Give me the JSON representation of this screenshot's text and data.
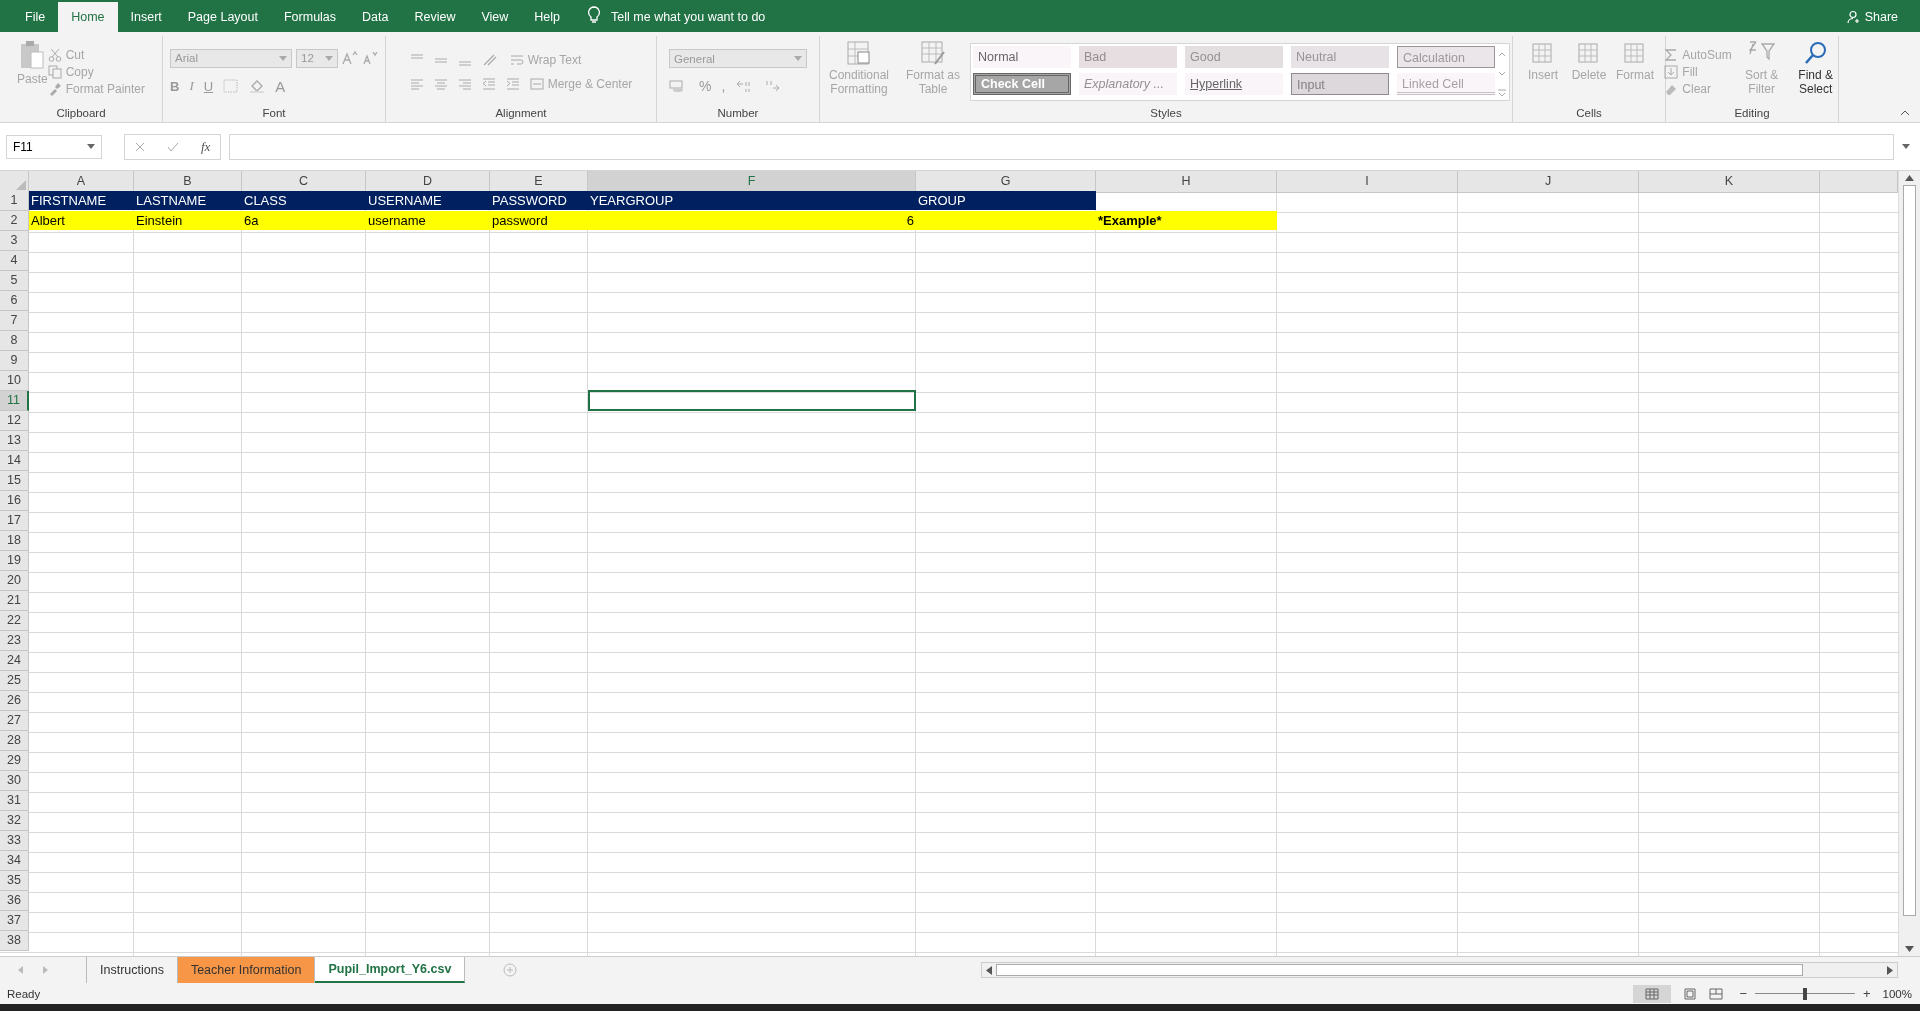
{
  "menu_tabs": [
    {
      "label": "File",
      "selected": false
    },
    {
      "label": "Home",
      "selected": true
    },
    {
      "label": "Insert",
      "selected": false
    },
    {
      "label": "Page Layout",
      "selected": false
    },
    {
      "label": "Formulas",
      "selected": false
    },
    {
      "label": "Data",
      "selected": false
    },
    {
      "label": "Review",
      "selected": false
    },
    {
      "label": "View",
      "selected": false
    },
    {
      "label": "Help",
      "selected": false
    }
  ],
  "tell_me": "Tell me what you want to do",
  "share": "Share",
  "clipboard": {
    "label": "Clipboard",
    "paste": {
      "label": "Paste",
      "disabled": true
    },
    "cut": {
      "label": "Cut",
      "disabled": true
    },
    "copy": {
      "label": "Copy",
      "disabled": true
    },
    "format_painter": {
      "label": "Format Painter",
      "disabled": true
    }
  },
  "font": {
    "label": "Font",
    "font_name": "Arial",
    "font_size": "12",
    "bold": "B",
    "italic": "I",
    "underline": "U",
    "font_color": "A"
  },
  "alignment": {
    "label": "Alignment",
    "wrap_text": {
      "label": "Wrap Text",
      "disabled": true
    },
    "merge": {
      "label": "Merge & Center",
      "disabled": true
    }
  },
  "number": {
    "label": "Number",
    "format": "General",
    "percent": "%",
    "comma": ","
  },
  "styles": {
    "label": "Styles",
    "conditional": {
      "label": "Conditional Formatting",
      "disabled": true
    },
    "format_table": {
      "label": "Format as Table",
      "disabled": true
    },
    "cells": [
      {
        "label": "Normal",
        "kind": "normal"
      },
      {
        "label": "Bad",
        "kind": "bad"
      },
      {
        "label": "Good",
        "kind": "good"
      },
      {
        "label": "Neutral",
        "kind": "neutral"
      },
      {
        "label": "Calculation",
        "kind": "calculation"
      },
      {
        "label": "Check Cell",
        "kind": "check"
      },
      {
        "label": "Explanatory ...",
        "kind": "explanatory"
      },
      {
        "label": "Hyperlink",
        "kind": "hyperlink"
      },
      {
        "label": "Input",
        "kind": "input"
      },
      {
        "label": "Linked Cell",
        "kind": "linked"
      }
    ]
  },
  "cells_group": {
    "label": "Cells",
    "buttons": [
      {
        "label": "Insert",
        "disabled": true
      },
      {
        "label": "Delete",
        "disabled": true
      },
      {
        "label": "Format",
        "disabled": true
      }
    ]
  },
  "editing": {
    "label": "Editing",
    "autosum": {
      "label": "AutoSum",
      "disabled": true
    },
    "fill": {
      "label": "Fill",
      "disabled": true
    },
    "clear": {
      "label": "Clear",
      "disabled": true
    },
    "sort": {
      "label": "Sort & Filter",
      "disabled": true
    },
    "find": {
      "label": "Find & Select",
      "disabled": false
    }
  },
  "name_box": "F11",
  "function_label": "fx",
  "columns": [
    {
      "label": "A",
      "selected": false
    },
    {
      "label": "B",
      "selected": false
    },
    {
      "label": "C",
      "selected": false
    },
    {
      "label": "D",
      "selected": false
    },
    {
      "label": "E",
      "selected": false
    },
    {
      "label": "F",
      "selected": true
    },
    {
      "label": "G",
      "selected": false
    },
    {
      "label": "H",
      "selected": false
    },
    {
      "label": "I",
      "selected": false
    },
    {
      "label": "J",
      "selected": false
    },
    {
      "label": "K",
      "selected": false
    }
  ],
  "rows": [
    {
      "number": "1",
      "selected": false,
      "cells": [
        {
          "text": "FIRSTNAME",
          "color": "#002060"
        },
        {
          "text": "LASTNAME",
          "color": "#002060"
        },
        {
          "text": "CLASS",
          "color": "#002060"
        },
        {
          "text": "USERNAME",
          "color": "#002060"
        },
        {
          "text": "PASSWORD",
          "color": "#002060"
        },
        {
          "text": "YEARGROUP",
          "color": "#002060"
        },
        {
          "text": "GROUP",
          "color": "#002060"
        }
      ]
    },
    {
      "number": "2",
      "selected": false,
      "cells": [
        {
          "text": "Albert",
          "color": "#ffff00"
        },
        {
          "text": "Einstein",
          "color": "#ffff00"
        },
        {
          "text": "6a",
          "color": "#ffff00"
        },
        {
          "text": "username",
          "color": "#ffff00"
        },
        {
          "text": "password",
          "color": "#ffff00"
        },
        {
          "text": "6",
          "color": "#ffff00",
          "kind": "number"
        },
        {
          "color": "#ffff00"
        },
        {
          "text": "*Example*",
          "color": "#ffff00",
          "bold": true
        }
      ]
    },
    {
      "number": "3",
      "selected": false
    },
    {
      "number": "4",
      "selected": false
    },
    {
      "number": "5",
      "selected": false
    },
    {
      "number": "6",
      "selected": false
    },
    {
      "number": "7",
      "selected": false
    },
    {
      "number": "8",
      "selected": false
    },
    {
      "number": "9",
      "selected": false
    },
    {
      "number": "10",
      "selected": false
    },
    {
      "number": "11",
      "selected": true
    },
    {
      "number": "12",
      "selected": false
    },
    {
      "number": "13",
      "selected": false
    },
    {
      "number": "14",
      "selected": false
    },
    {
      "number": "15",
      "selected": false
    },
    {
      "number": "16",
      "selected": false
    },
    {
      "number": "17",
      "selected": false
    },
    {
      "number": "18",
      "selected": false
    },
    {
      "number": "19",
      "selected": false
    },
    {
      "number": "20",
      "selected": false
    },
    {
      "number": "21",
      "selected": false
    },
    {
      "number": "22",
      "selected": false
    },
    {
      "number": "23",
      "selected": false
    },
    {
      "number": "24",
      "selected": false
    },
    {
      "number": "25",
      "selected": false
    },
    {
      "number": "26",
      "selected": false
    },
    {
      "number": "27",
      "selected": false
    },
    {
      "number": "28",
      "selected": false
    },
    {
      "number": "29",
      "selected": false
    },
    {
      "number": "30",
      "selected": false
    },
    {
      "number": "31",
      "selected": false
    },
    {
      "number": "32",
      "selected": false
    },
    {
      "number": "33",
      "selected": false
    },
    {
      "number": "34",
      "selected": false
    },
    {
      "number": "35",
      "selected": false
    },
    {
      "number": "36",
      "selected": false
    },
    {
      "number": "37",
      "selected": false
    },
    {
      "number": "38",
      "selected": false
    }
  ],
  "sheet_tabs": [
    {
      "label": "Instructions",
      "selected": false
    },
    {
      "label": "Teacher Information",
      "selected": false,
      "color": "#f79646"
    },
    {
      "label": "Pupil_Import_Y6.csv",
      "selected": true
    }
  ],
  "status": "Ready",
  "zoom_out": "−",
  "zoom_in": "+",
  "zoom_slider": {
    "level": 0.5
  },
  "zoom": "100%"
}
